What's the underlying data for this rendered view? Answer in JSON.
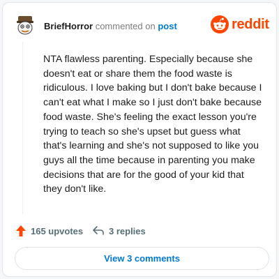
{
  "header": {
    "username": "BriefHorror",
    "action_text": "commented on",
    "target_text": "post",
    "brand": "reddit",
    "brand_color": "#ff4500"
  },
  "comment": {
    "body": "NTA flawless parenting. Especially because she doesn't eat or share them the food waste is ridiculous. I love baking but I don't bake because I can't eat what I make so I just don't bake because food waste. She's feeling the exact lesson you're trying to teach so she's upset but guess what that's learning and she's not supposed to like you guys all the time because in parenting you make decisions that are for the good of your kid that they don't like."
  },
  "actions": {
    "upvote_icon": "upvote-arrow-icon",
    "upvotes_label": "165 upvotes",
    "reply_icon": "reply-arrow-icon",
    "replies_label": "3 replies"
  },
  "footer": {
    "view_comments_label": "View 3 comments"
  },
  "colors": {
    "accent": "#0079d3",
    "upvote": "#ff4500",
    "muted": "#576f76"
  }
}
